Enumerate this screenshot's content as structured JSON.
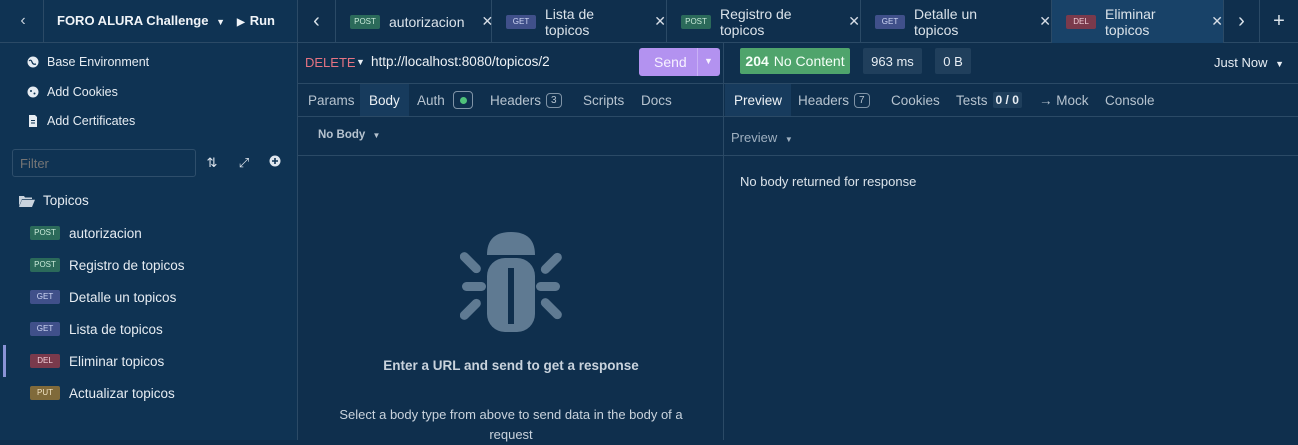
{
  "sidebar": {
    "project_title": "FORO ALURA Challenge",
    "run_label": "Run",
    "links": [
      {
        "label": "Base Environment",
        "icon": "globe-icon"
      },
      {
        "label": "Add Cookies",
        "icon": "cookie-icon"
      },
      {
        "label": "Add Certificates",
        "icon": "certificate-icon"
      }
    ],
    "filter_placeholder": "Filter",
    "folder": "Topicos",
    "requests": [
      {
        "method": "POST",
        "name": "autorizacion"
      },
      {
        "method": "POST",
        "name": "Registro de topicos"
      },
      {
        "method": "GET",
        "name": "Detalle un topicos"
      },
      {
        "method": "GET",
        "name": "Lista de topicos"
      },
      {
        "method": "DEL",
        "name": "Eliminar topicos"
      },
      {
        "method": "PUT",
        "name": "Actualizar topicos"
      }
    ]
  },
  "tabs": [
    {
      "method": "POST",
      "label": "autorizacion"
    },
    {
      "method": "GET",
      "label": "Lista de topicos"
    },
    {
      "method": "POST",
      "label": "Registro de topicos"
    },
    {
      "method": "GET",
      "label": "Detalle un topicos"
    },
    {
      "method": "DEL",
      "label": "Eliminar topicos"
    }
  ],
  "request": {
    "method": "DELETE",
    "url": "http://localhost:8080/topicos/2",
    "send_label": "Send",
    "subtabs": [
      "Params",
      "Body",
      "Auth",
      "Headers",
      "Scripts",
      "Docs"
    ],
    "headers_count": "3",
    "body_type": "No Body",
    "empty_title": "Enter a URL and send to get a response",
    "empty_desc": "Select a body type from above to send data in the body of a request"
  },
  "response": {
    "status_code": "204",
    "status_text": "No Content",
    "time": "963 ms",
    "size": "0 B",
    "timestamp": "Just Now",
    "subtabs": [
      "Preview",
      "Headers",
      "Cookies",
      "Tests",
      "→ Mock",
      "Console"
    ],
    "headers_count": "7",
    "tests_count": "0 / 0",
    "preview_label": "Preview",
    "message": "No body returned for response"
  },
  "colors": {
    "background": "#0f2f4d",
    "sidebar": "#0f3353",
    "send": "#b392f0",
    "status_ok": "#4fa46c",
    "delete_method": "#e57382"
  }
}
